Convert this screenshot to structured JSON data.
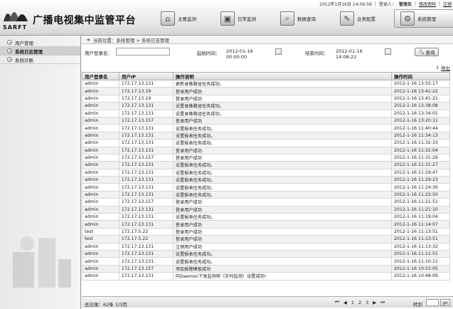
{
  "header": {
    "logo_text": "SARFT",
    "app_title": "广播电视集中监管平台",
    "date_text": "2012年1月16日 14:09:59",
    "login_label": "登录人：",
    "login_user": "管理员",
    "change_password": "修改密码",
    "logout": "注销"
  },
  "nav": [
    {
      "label": "主要监测",
      "icon": "home-icon"
    },
    {
      "label": "日常监测",
      "icon": "monitor-icon"
    },
    {
      "label": "数据查询",
      "icon": "search-data-icon"
    },
    {
      "label": "业务配置",
      "icon": "config-icon"
    },
    {
      "label": "系统管理",
      "icon": "system-icon",
      "active": true
    }
  ],
  "sidebar": {
    "items": [
      {
        "label": "用户管理"
      },
      {
        "label": "系统日志管理",
        "active": true
      },
      {
        "label": "系统诊断"
      }
    ]
  },
  "breadcrumb": "当前位置：系统管理 > 系统日志管理",
  "search": {
    "user_label": "用户登录名：",
    "user_value": "",
    "start_label": "起始时间：",
    "start_value": "2012-01-16 00:00:00",
    "end_label": "结束时间：",
    "end_value": "2012-01-16 14:08:22",
    "query_button": "查询"
  },
  "export_label": "导出",
  "table": {
    "columns": [
      "用户登录名",
      "用户IP",
      "操作说明",
      "操作时间"
    ],
    "rows": [
      [
        "admin",
        "172.17.13.131",
        "更新录像路径任务成功。",
        "2012-1-16 13:55:17"
      ],
      [
        "admin",
        "172.17.13.19",
        "登录用户成功",
        "2012-1-16 13:41:22"
      ],
      [
        "admin",
        "172.17.13.19",
        "登录用户成功",
        "2012-1-16 13:41:21"
      ],
      [
        "admin",
        "172.17.13.131",
        "设置录像路径任务成功。",
        "2012-1-16 13:38:08"
      ],
      [
        "admin",
        "172.17.13.131",
        "设置录像路径任务成功。",
        "2012-1-16 13:34:01"
      ],
      [
        "admin",
        "172.17.13.157",
        "登录用户成功",
        "2012-1-16 13:20:11"
      ],
      [
        "admin",
        "172.17.13.131",
        "设置报表任务成功。",
        "2012-1-16 11:40:44"
      ],
      [
        "admin",
        "172.17.13.131",
        "设置报表任务成功。",
        "2012-1-16 11:34:13"
      ],
      [
        "admin",
        "172.17.13.131",
        "设置报表任务成功。",
        "2012-1-16 11:32:33"
      ],
      [
        "admin",
        "172.17.13.131",
        "登录用户成功",
        "2012-1-16 11:32:04"
      ],
      [
        "admin",
        "172.17.13.157",
        "登录用户成功",
        "2012-1-16 11:31:29"
      ],
      [
        "admin",
        "172.17.13.131",
        "设置报表任务成功。",
        "2012-1-16 11:31:27"
      ],
      [
        "admin",
        "172.17.13.131",
        "设置报表任务成功。",
        "2012-1-16 11:29:47"
      ],
      [
        "admin",
        "172.17.13.131",
        "设置报表任务成功。",
        "2012-1-16 11:29:23"
      ],
      [
        "admin",
        "172.17.13.131",
        "设置报表任务成功。",
        "2012-1-16 11:24:30"
      ],
      [
        "admin",
        "172.17.13.131",
        "设置报表任务成功。",
        "2012-1-16 11:22:50"
      ],
      [
        "admin",
        "172.17.13.157",
        "登录用户成功",
        "2012-1-16 11:21:51"
      ],
      [
        "admin",
        "172.17.13.131",
        "登录用户成功",
        "2012-1-16 11:21:10"
      ],
      [
        "admin",
        "172.17.13.131",
        "设置报表任务成功。",
        "2012-1-16 11:19:04"
      ],
      [
        "admin",
        "172.17.13.131",
        "登录用户成功",
        "2012-1-16 11:14:07"
      ],
      [
        "test",
        "172.17.5.22",
        "登录用户成功",
        "2012-1-16 11:13:51"
      ],
      [
        "test",
        "172.17.5.22",
        "登录用户成功",
        "2012-1-16 11:13:51"
      ],
      [
        "admin",
        "172.17.13.131",
        "注销用户成功",
        "2012-1-16 11:13:32"
      ],
      [
        "admin",
        "172.17.13.131",
        "设置报表任务成功。",
        "2012-1-16 11:11:51"
      ],
      [
        "admin",
        "172.17.13.131",
        "设置报表任务成功。",
        "2012-1-16 11:10:11"
      ],
      [
        "admin",
        "172.17.13.157",
        "添加报警模板成功",
        "2012-1-16 10:53:05"
      ],
      [
        "admin",
        "172.17.13.131",
        "向Daemon下发监测项（实时监测）设置成功!",
        "2012-1-16 10:48:09"
      ]
    ]
  },
  "pager": {
    "summary": "总记录：62条 1/3页",
    "first": "⏮",
    "prev": "◀",
    "pages": [
      "1",
      "2",
      "3"
    ],
    "next": "▶",
    "last": "⏭",
    "goto_label": "转到",
    "go_button": "go"
  }
}
